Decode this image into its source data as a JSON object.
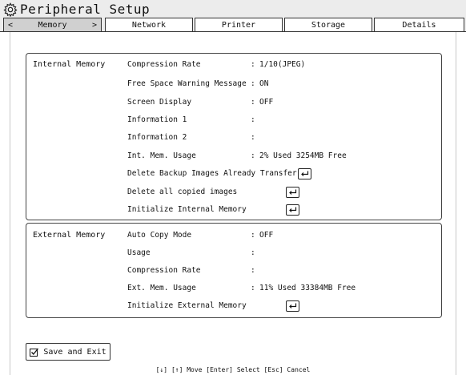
{
  "window": {
    "title": "Peripheral Setup"
  },
  "tabs": [
    {
      "label": "Memory",
      "left_arrow": "<",
      "right_arrow": ">",
      "active": true
    },
    {
      "label": "Network"
    },
    {
      "label": "Printer"
    },
    {
      "label": "Storage"
    },
    {
      "label": "Details"
    }
  ],
  "internal": {
    "title": "Internal Memory",
    "rows": [
      {
        "label": "Compression Rate",
        "sep": ":",
        "value": "1/10(JPEG)"
      },
      {
        "label": "Free Space Warning Message",
        "sep": ":",
        "value": "ON"
      },
      {
        "label": "Screen Display",
        "sep": ":",
        "value": "OFF"
      },
      {
        "label": "Information 1",
        "sep": ":",
        "value": ""
      },
      {
        "label": "Information 2",
        "sep": ":",
        "value": ""
      },
      {
        "label": "Int. Mem. Usage",
        "sep": ":",
        "value": "2% Used 3254MB Free"
      },
      {
        "label": "Delete Backup Images Already Transferred"
      },
      {
        "label": "Delete all copied images"
      },
      {
        "label": "Initialize Internal Memory"
      }
    ]
  },
  "external": {
    "title": "External Memory",
    "rows": [
      {
        "label": "Auto Copy Mode",
        "sep": ":",
        "value": "OFF"
      },
      {
        "label": "Usage",
        "sep": ":",
        "value": ""
      },
      {
        "label": "Compression Rate",
        "sep": ":",
        "value": ""
      },
      {
        "label": "Ext. Mem. Usage",
        "sep": ":",
        "value": "11% Used 33384MB Free"
      },
      {
        "label": "Initialize External Memory"
      }
    ]
  },
  "footer": {
    "save_label": "Save and Exit",
    "help": "[↓] [↑] Move  [Enter] Select  [Esc] Cancel"
  },
  "icons": {
    "title": "gear-icon",
    "enter": "enter-key-icon",
    "save": "checkbox-icon"
  }
}
